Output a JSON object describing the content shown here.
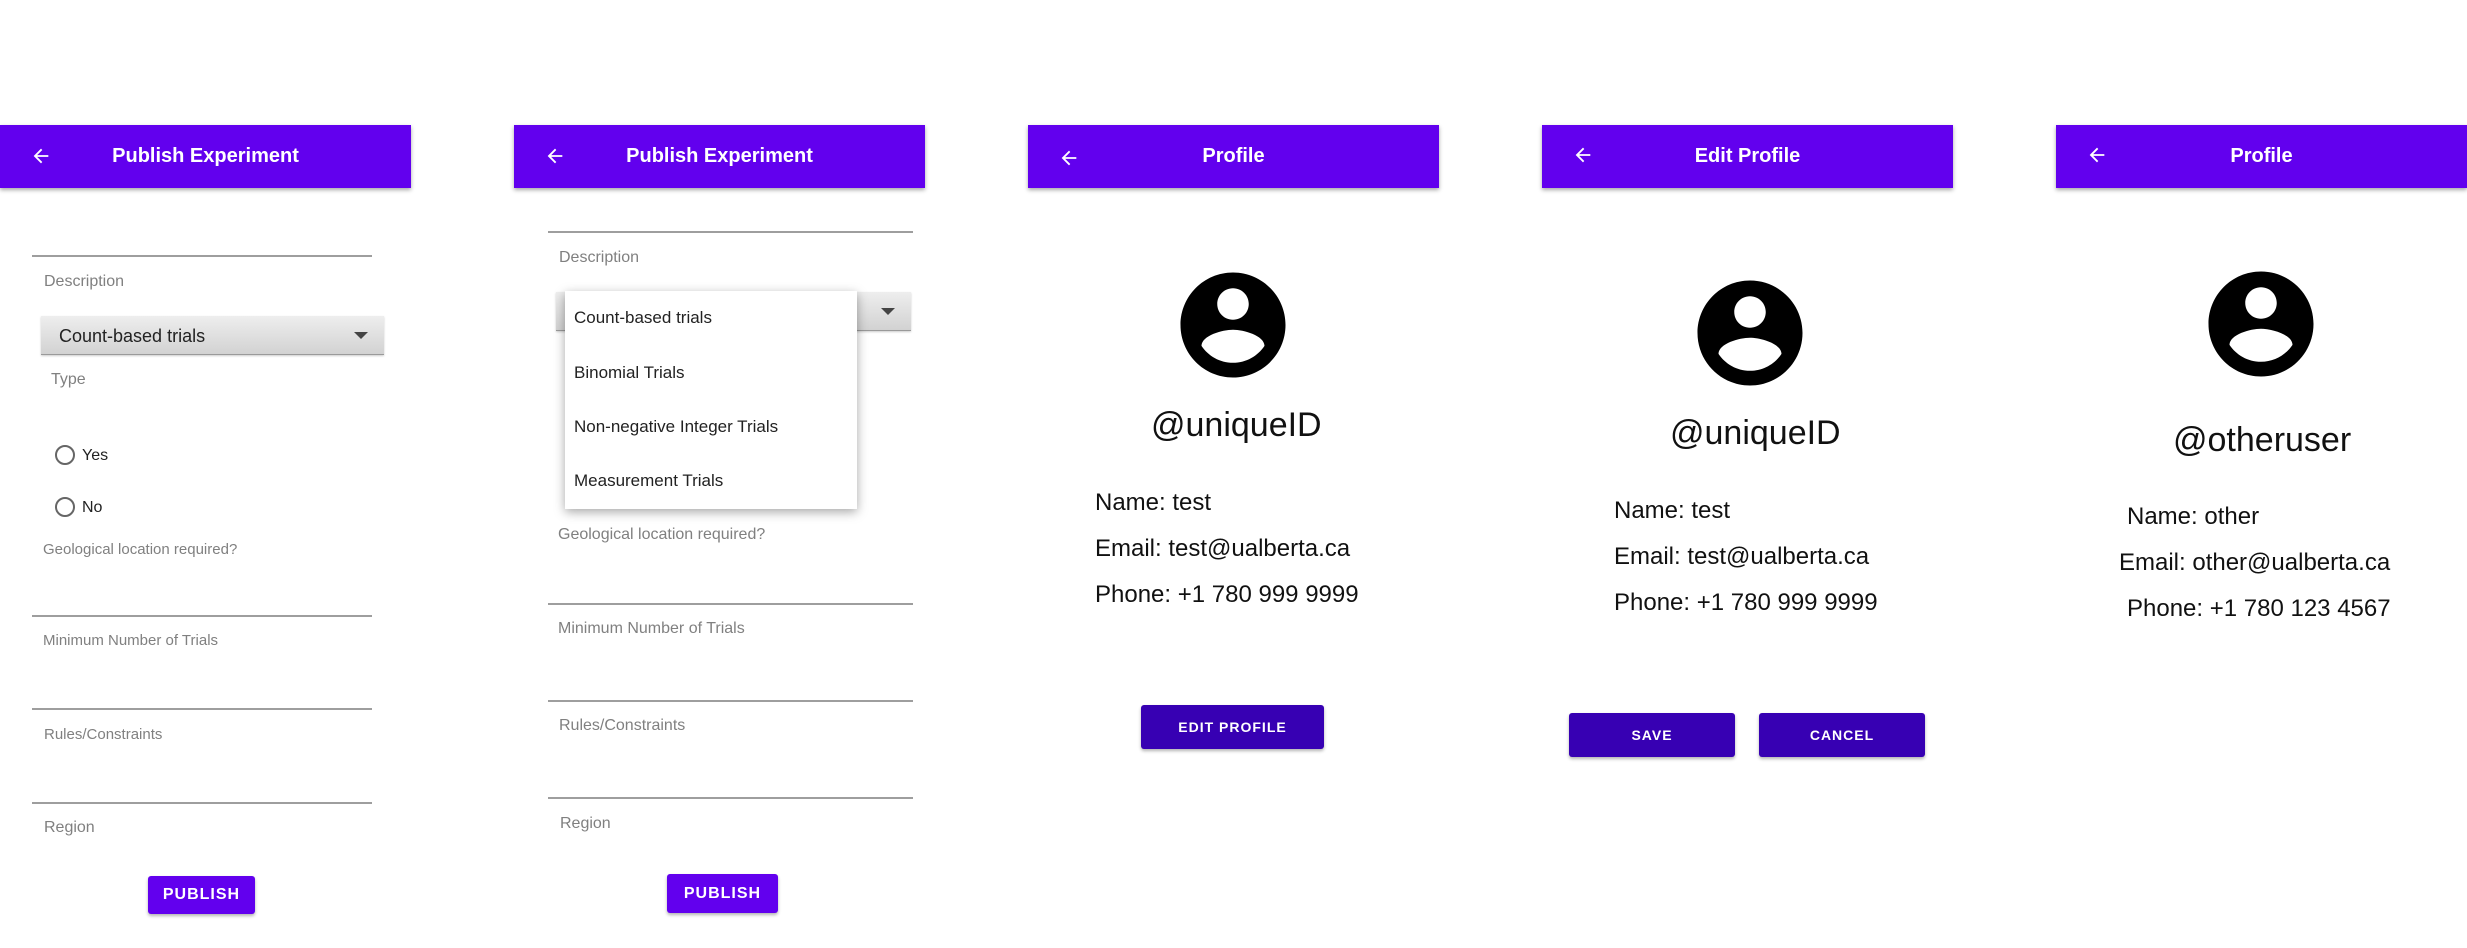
{
  "colors": {
    "primary": "#6200ee",
    "primary_dark": "#3700b3"
  },
  "screens": [
    {
      "title": "Publish Experiment",
      "description_hint": "Description",
      "spinner_value": "Count-based trials",
      "type_hint": "Type",
      "radio_yes": "Yes",
      "radio_no": "No",
      "geo_hint": "Geological location required?",
      "min_trials_hint": "Minimum Number of Trials",
      "rules_hint": "Rules/Constraints",
      "region_hint": "Region",
      "publish_label": "PUBLISH"
    },
    {
      "title": "Publish Experiment",
      "description_hint": "Description",
      "dropdown_options": [
        "Count-based trials",
        "Binomial Trials",
        "Non-negative Integer Trials",
        "Measurement Trials"
      ],
      "geo_hint": "Geological location required?",
      "min_trials_hint": "Minimum Number of Trials",
      "rules_hint": "Rules/Constraints",
      "region_hint": "Region",
      "publish_label": "PUBLISH"
    },
    {
      "title": "Profile",
      "handle": "@uniqueID",
      "name": "Name: test",
      "email": "Email: test@ualberta.ca",
      "phone": "Phone: +1 780 999 9999",
      "edit_label": "EDIT PROFILE"
    },
    {
      "title": "Edit Profile",
      "handle": "@uniqueID",
      "name": "Name: test",
      "email": "Email: test@ualberta.ca",
      "phone": "Phone: +1 780 999 9999",
      "save_label": "SAVE",
      "cancel_label": "CANCEL"
    },
    {
      "title": "Profile",
      "handle": "@otheruser",
      "name": "Name: other",
      "email": "Email: other@ualberta.ca",
      "phone": "Phone: +1 780 123 4567"
    }
  ]
}
